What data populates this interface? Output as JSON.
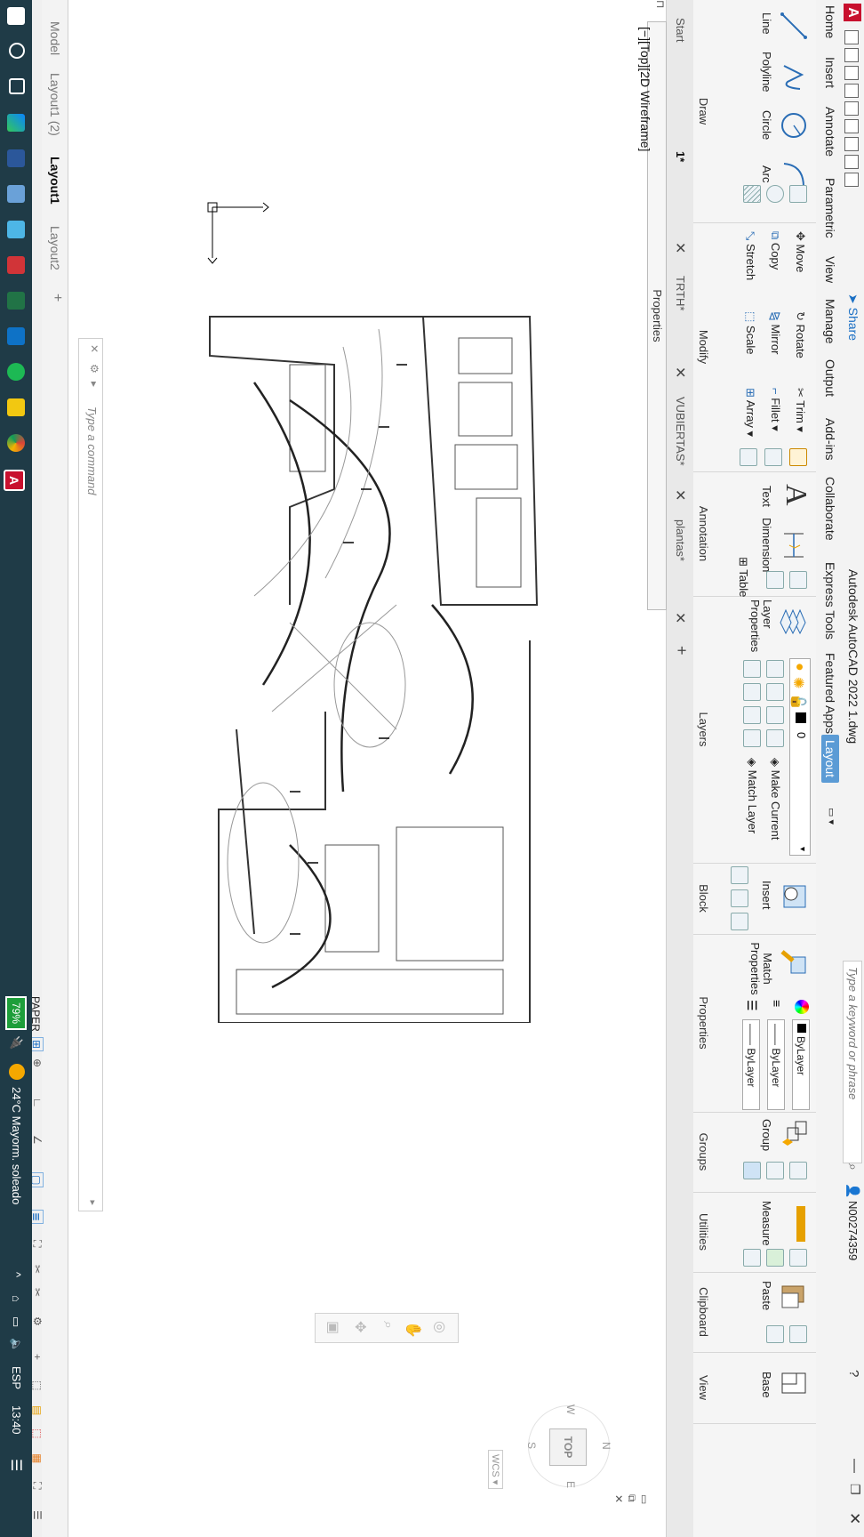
{
  "titlebar": {
    "app_title": "Autodesk AutoCAD 2022   1.dwg",
    "search_placeholder": "Type a keyword or phrase",
    "user": "N00274359",
    "share": "Share"
  },
  "ribbon_tabs": [
    "Home",
    "Insert",
    "Annotate",
    "Parametric",
    "View",
    "Manage",
    "Output",
    "Add-ins",
    "Collaborate",
    "Express Tools",
    "Featured Apps",
    "Layout"
  ],
  "panels": {
    "draw": {
      "title": "Draw",
      "items": [
        "Line",
        "Polyline",
        "Circle",
        "Arc"
      ]
    },
    "modify": {
      "title": "Modify",
      "items": [
        "Move",
        "Rotate",
        "Trim",
        "Copy",
        "Mirror",
        "Fillet",
        "Stretch",
        "Scale",
        "Array"
      ]
    },
    "annotation": {
      "title": "Annotation",
      "items": [
        "Text",
        "Dimension",
        "Table"
      ]
    },
    "layers": {
      "title": "Layers",
      "items": [
        "Layer Properties",
        "Make Current",
        "Match Layer"
      ],
      "current_layer": "0"
    },
    "block": {
      "title": "Block",
      "items": [
        "Insert"
      ]
    },
    "properties": {
      "title": "Properties",
      "items": [
        "Match Properties"
      ],
      "color": "ByLayer",
      "linetype": "ByLayer",
      "lineweight": "ByLayer"
    },
    "groups": {
      "title": "Groups",
      "items": [
        "Group"
      ]
    },
    "utilities": {
      "title": "Utilities",
      "items": [
        "Measure"
      ]
    },
    "clipboard": {
      "title": "Clipboard",
      "items": [
        "Paste"
      ]
    },
    "view": {
      "title": "View",
      "items": [
        "Base"
      ]
    }
  },
  "doc_tabs": [
    "Start",
    "1*",
    "TRTH*",
    "VUBIERTAS*",
    "plantas*"
  ],
  "properties_bar": "Properties",
  "viewport_label": "[−][Top][2D Wireframe]",
  "command_placeholder": "Type a command",
  "layout_tabs": [
    "Model",
    "Layout1 (2)",
    "Layout1",
    "Layout2"
  ],
  "active_layout": "Layout1",
  "status": {
    "space": "PAPER"
  },
  "viewcube": {
    "face": "TOP",
    "n": "N",
    "s": "S",
    "e": "E",
    "w": "W",
    "wcs": "WCS"
  },
  "taskbar": {
    "battery": "79%",
    "weather": "24°C  Mayorm. soleado",
    "lang": "ESP",
    "time": "13:40"
  }
}
